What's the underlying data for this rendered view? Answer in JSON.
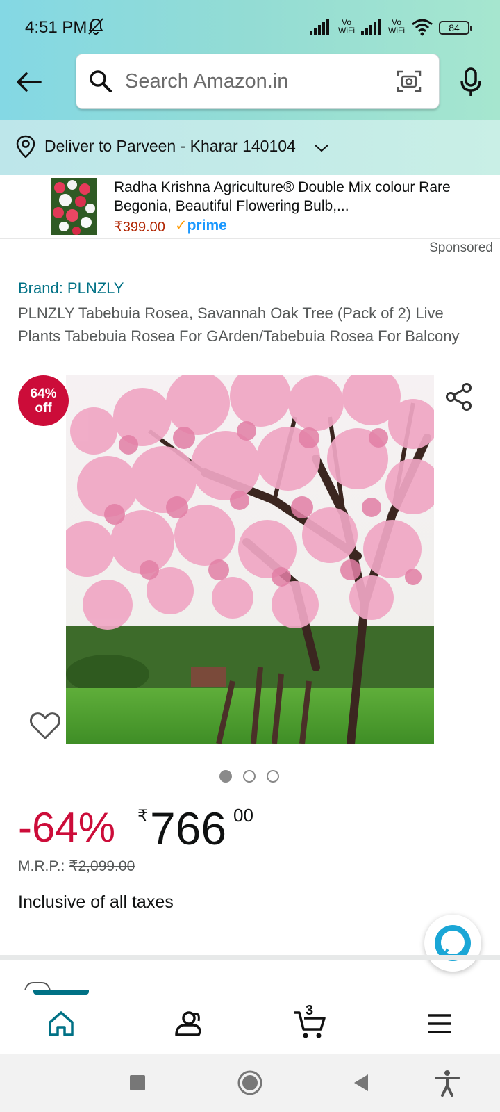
{
  "status_bar": {
    "time": "4:51 PM",
    "network_label_1": "Vo WiFi",
    "network_label_2": "Vo WiFi",
    "battery": "84"
  },
  "search": {
    "placeholder": "Search Amazon.in"
  },
  "delivery": {
    "text": "Deliver to Parveen - Kharar 140104"
  },
  "sponsored_ad": {
    "title": "Radha Krishna Agriculture® Double Mix colour Rare Begonia, Beautiful Flowering Bulb,...",
    "price": "₹399.00",
    "prime_check": "✓",
    "prime_label": "prime",
    "sponsored_label": "Sponsored"
  },
  "product": {
    "brand": "Brand: PLNZLY",
    "title": "PLNZLY Tabebuia Rosea, Savannah Oak Tree (Pack of 2) Live Plants Tabebuia Rosea For GArden/Tabebuia Rosea For Balcony",
    "discount_badge_pct": "64%",
    "discount_badge_off": "off",
    "image_count": 3,
    "active_image_index": 0,
    "price": {
      "discount": "-64%",
      "currency": "₹",
      "whole": "766",
      "fraction": "00"
    },
    "mrp_label": "M.R.P.:",
    "mrp_value": "₹2,099.00",
    "tax_note": "Inclusive of all taxes"
  },
  "bottom_nav": {
    "items": [
      "home",
      "profile",
      "cart",
      "menu"
    ],
    "cart_count": "3",
    "active": "home"
  },
  "colors": {
    "accent_teal": "#007185",
    "deal_red": "#cc0c39",
    "price_red": "#b12704",
    "prime_blue": "#1a98ff"
  },
  "icons": [
    "back-arrow-icon",
    "search-icon",
    "camera-icon",
    "mic-icon",
    "location-pin-icon",
    "chevron-down-icon",
    "share-icon",
    "heart-icon",
    "alexa-icon",
    "home-icon",
    "profile-icon",
    "cart-icon",
    "hamburger-menu-icon"
  ]
}
